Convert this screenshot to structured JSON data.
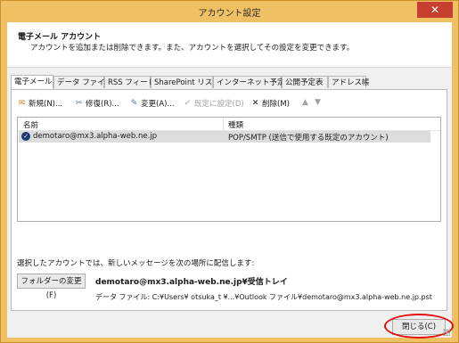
{
  "window": {
    "title": "アカウント設定",
    "close_glyph": "✕"
  },
  "header": {
    "title": "電子メール アカウント",
    "description": "アカウントを追加または削除できます。また、アカウントを選択してその設定を変更できます。"
  },
  "tabs": [
    {
      "label": "電子メール",
      "active": true
    },
    {
      "label": "データ ファイル",
      "active": false
    },
    {
      "label": "RSS フィード",
      "active": false
    },
    {
      "label": "SharePoint リスト",
      "active": false
    },
    {
      "label": "インターネット予定表",
      "active": false
    },
    {
      "label": "公開予定表",
      "active": false
    },
    {
      "label": "アドレス帳",
      "active": false
    }
  ],
  "toolbar": {
    "new": {
      "label": "新規(N)...",
      "icon": "new-account-icon"
    },
    "repair": {
      "label": "修復(R)...",
      "icon": "repair-icon"
    },
    "change": {
      "label": "変更(A)...",
      "icon": "change-icon"
    },
    "set_default": {
      "label": "既定に設定(D)",
      "icon": "set-default-icon",
      "disabled": true
    },
    "delete": {
      "label": "削除(M)",
      "icon": "delete-icon"
    },
    "move_up": {
      "icon": "arrow-up-icon",
      "disabled": true
    },
    "move_down": {
      "icon": "arrow-down-icon",
      "disabled": true
    }
  },
  "accounts_list": {
    "columns": [
      "名前",
      "種類"
    ],
    "rows": [
      {
        "name": "demotaro@mx3.alpha-web.ne.jp",
        "type": "POP/SMTP (送信で使用する既定のアカウント)",
        "default": true
      }
    ]
  },
  "delivery": {
    "label": "選択したアカウントでは、新しいメッセージを次の場所に配信します:",
    "change_folder_button": "フォルダーの変更(F)",
    "folder": "demotaro@mx3.alpha-web.ne.jp¥受信トレイ",
    "data_file": "データ ファイル: C:¥Users¥ otsuka_t ¥...¥Outlook ファイル¥demotaro@mx3.alpha-web.ne.jp.pst"
  },
  "footer": {
    "close_button": "閉じる(C)"
  },
  "colors": {
    "title_bar": "#f0c064",
    "close_x": "#c7402f",
    "highlight": "#e01010",
    "selected_row": "#dcdcdc"
  }
}
